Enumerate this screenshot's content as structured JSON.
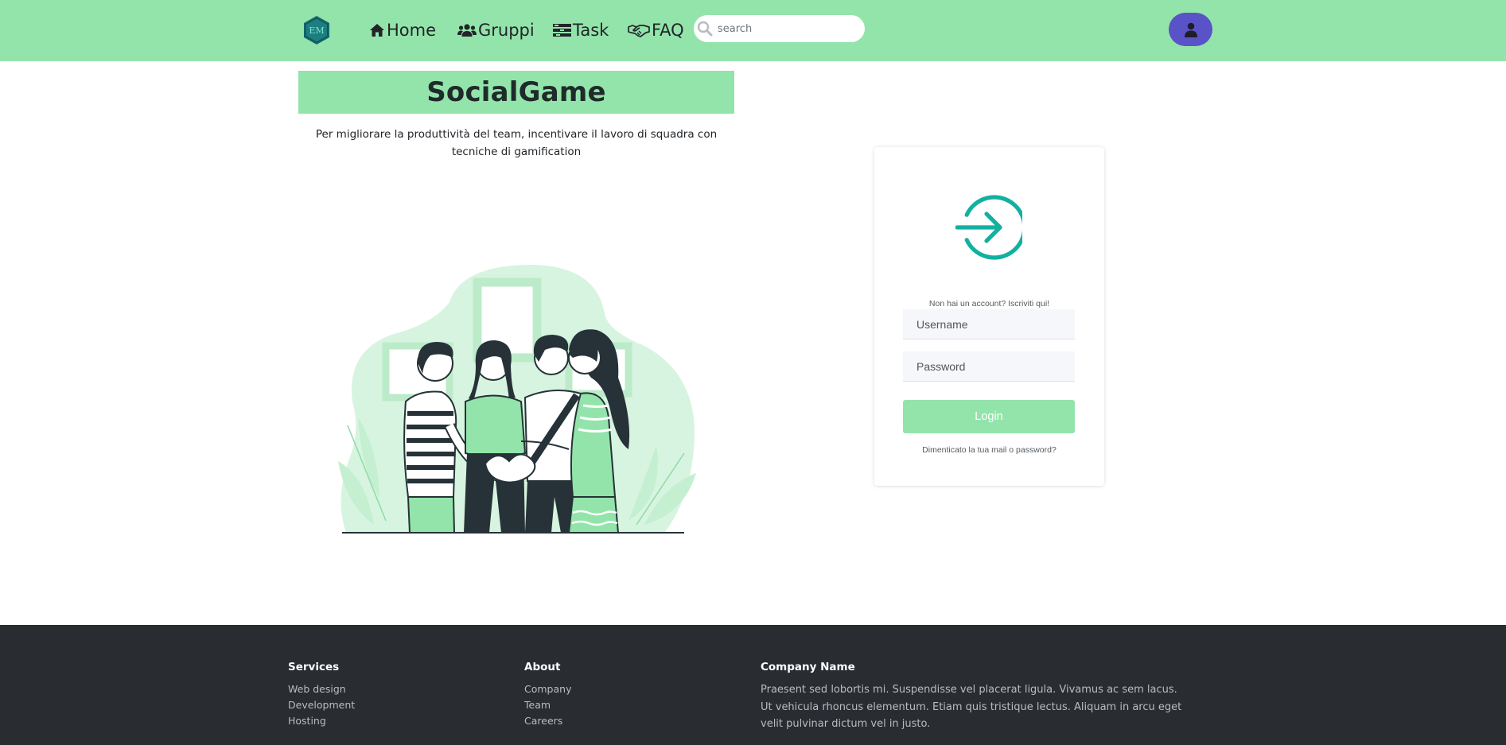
{
  "brand": {
    "logo_text": "EM"
  },
  "navbar": {
    "items": [
      {
        "label": "Home",
        "icon": "home-icon"
      },
      {
        "label": "Gruppi",
        "icon": "users-icon"
      },
      {
        "label": "Task",
        "icon": "tasks-icon"
      },
      {
        "label": "FAQ",
        "icon": "handshake-icon"
      }
    ],
    "search": {
      "placeholder": "search",
      "value": ""
    },
    "user_button_icon": "user-icon"
  },
  "hero": {
    "title": "SocialGame",
    "description": "Per migliorare la produttività del team, incentivare il lavoro di squadra con tecniche di gamification",
    "illustration": "team-hands-together-illustration"
  },
  "login": {
    "icon": "sign-in-icon",
    "signup_text": "Non hai un account? Iscriviti qui!",
    "username_placeholder": "Username",
    "password_placeholder": "Password",
    "button_label": "Login",
    "forgot_text": "Dimenticato la tua mail o password?"
  },
  "footer": {
    "services": {
      "heading": "Services",
      "items": [
        "Web design",
        "Development",
        "Hosting"
      ]
    },
    "about": {
      "heading": "About",
      "items": [
        "Company",
        "Team",
        "Careers"
      ]
    },
    "company": {
      "heading": "Company Name",
      "text": "Praesent sed lobortis mi. Suspendisse vel placerat ligula. Vivamus ac sem lacus. Ut vehicula rhoncus elementum. Etiam quis tristique lectus. Aliquam in arcu eget velit pulvinar dictum vel in justo."
    }
  },
  "colors": {
    "navbar_bg": "#93e4aa",
    "accent_teal": "#13b0a0",
    "user_button_bg": "#5a53c8",
    "footer_bg": "#292d32"
  }
}
